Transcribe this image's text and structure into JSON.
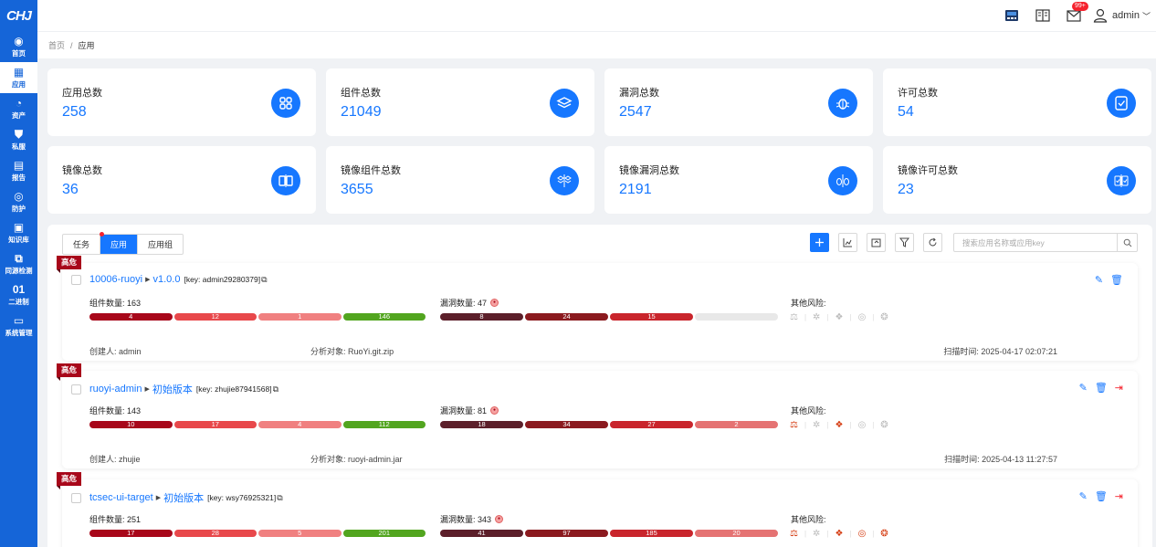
{
  "sidebar": {
    "logo": "CHJ",
    "items": [
      {
        "label": "首页",
        "icon": "dashboard-icon",
        "glyph": "◉"
      },
      {
        "label": "应用",
        "icon": "apps-icon",
        "glyph": "▦",
        "active": true
      },
      {
        "label": "资产",
        "icon": "pie-chart-icon",
        "glyph": "◔"
      },
      {
        "label": "私服",
        "icon": "shield-icon",
        "glyph": "⛊"
      },
      {
        "label": "报告",
        "icon": "report-icon",
        "glyph": "▤"
      },
      {
        "label": "防护",
        "icon": "target-icon",
        "glyph": "◎"
      },
      {
        "label": "知识库",
        "icon": "book-icon",
        "glyph": "▣"
      },
      {
        "label": "同源检测",
        "icon": "code-icon",
        "glyph": "⧉"
      },
      {
        "label": "二进制",
        "icon": "binary-icon",
        "glyph": "01"
      },
      {
        "label": "系统管理",
        "icon": "monitor-icon",
        "glyph": "▭"
      }
    ]
  },
  "topbar": {
    "mail_badge": "99+",
    "user": "admin"
  },
  "breadcrumb": {
    "home": "首页",
    "sep": "/",
    "current": "应用"
  },
  "stats": [
    [
      {
        "label": "应用总数",
        "value": "258",
        "icon": "apps-grid-icon"
      },
      {
        "label": "组件总数",
        "value": "21049",
        "icon": "layers-icon"
      },
      {
        "label": "漏洞总数",
        "value": "2547",
        "icon": "bug-icon"
      },
      {
        "label": "许可总数",
        "value": "54",
        "icon": "license-icon"
      }
    ],
    [
      {
        "label": "镜像总数",
        "value": "36",
        "icon": "image-icon"
      },
      {
        "label": "镜像组件总数",
        "value": "3655",
        "icon": "image-layers-icon"
      },
      {
        "label": "镜像漏洞总数",
        "value": "2191",
        "icon": "image-bug-icon"
      },
      {
        "label": "镜像许可总数",
        "value": "23",
        "icon": "image-license-icon"
      }
    ]
  ],
  "tabs": [
    "任务",
    "应用",
    "应用组"
  ],
  "search": {
    "placeholder": "搜索应用名称或应用key"
  },
  "apps": [
    {
      "risk": "高危",
      "name": "10006-ruoyi",
      "version": "v1.0.0",
      "key": "[key: admin29280379]",
      "component_label": "组件数量: 163",
      "vuln_label": "漏洞数量: 47",
      "other_label": "其他风险:",
      "component_bar": [
        4,
        12,
        1,
        146
      ],
      "vuln_bar": [
        8,
        24,
        15
      ],
      "vuln_bar_empty": true,
      "creator": "创建人: admin",
      "target": "分析对象: RuoYi.git.zip",
      "scan_time": "扫描时间: 2025-04-17 02:07:21",
      "has_export": false
    },
    {
      "risk": "高危",
      "name": "ruoyi-admin",
      "version": "初始版本",
      "key": "[key: zhujie87941568]",
      "component_label": "组件数量: 143",
      "vuln_label": "漏洞数量: 81",
      "other_label": "其他风险:",
      "component_bar": [
        10,
        17,
        4,
        112
      ],
      "vuln_bar": [
        18,
        34,
        27,
        2
      ],
      "vuln_bar_empty": false,
      "creator": "创建人: zhujie",
      "target": "分析对象: ruoyi-admin.jar",
      "scan_time": "扫描时间: 2025-04-13 11:27:57",
      "has_export": true
    },
    {
      "risk": "高危",
      "name": "tcsec-ui-target",
      "version": "初始版本",
      "key": "[key: wsy76925321]",
      "component_label": "组件数量: 251",
      "vuln_label": "漏洞数量: 343",
      "other_label": "其他风险:",
      "component_bar": [
        17,
        28,
        5,
        201
      ],
      "vuln_bar": [
        41,
        97,
        185,
        20
      ],
      "vuln_bar_empty": false,
      "creator": "",
      "target": "",
      "scan_time": "",
      "has_export": true
    }
  ],
  "colors": {
    "primary": "#1677ff",
    "sidebar": "#1565d8",
    "critical": "#a8071a",
    "high": "#e8484b",
    "medium": "#f08080",
    "low": "#52a51f",
    "vuln_critical": "#5c1f2a",
    "vuln_high": "#8b1a1f",
    "vuln_medium": "#c9252c",
    "vuln_low": "#e57373"
  }
}
